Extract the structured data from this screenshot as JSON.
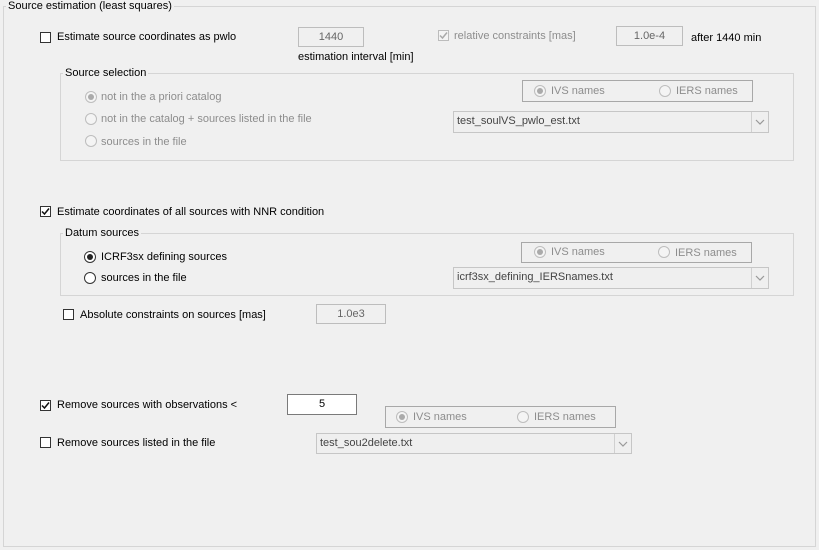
{
  "panel_title": "Source estimation (least squares)",
  "pwlo": {
    "checkbox_label": "Estimate source coordinates as pwlo",
    "interval_value": "1440",
    "interval_caption": "estimation interval [min]",
    "rel_constraints_label": "relative constraints [mas]",
    "rel_constraints_value": "1.0e-4",
    "after_label": "after 1440 min",
    "selection": {
      "legend": "Source selection",
      "radio1": "not in the a priori catalog",
      "radio2": "not in the catalog + sources listed in the file",
      "radio3": "sources in the file",
      "ivs_label": "IVS names",
      "iers_label": "IERS names",
      "file": "test_soulVS_pwlo_est.txt"
    }
  },
  "nnr": {
    "checkbox_label": "Estimate coordinates of all sources with NNR condition",
    "datum": {
      "legend": "Datum sources",
      "radio1": "ICRF3sx defining sources",
      "radio2": "sources in the file",
      "ivs_label": "IVS names",
      "iers_label": "IERS names",
      "file": "icrf3sx_defining_IERSnames.txt"
    },
    "abs_label": "Absolute constraints on sources [mas]",
    "abs_value": "1.0e3"
  },
  "remove": {
    "obs_label": "Remove sources with observations <",
    "obs_value": "5",
    "ivs_label": "IVS names",
    "iers_label": "IERS names",
    "file_label": "Remove sources listed in the file",
    "file": "test_sou2delete.txt"
  },
  "colors": {
    "background": "#f0f0f0",
    "border": "#d5d5d5",
    "disabled_text": "#8d8d8d"
  }
}
